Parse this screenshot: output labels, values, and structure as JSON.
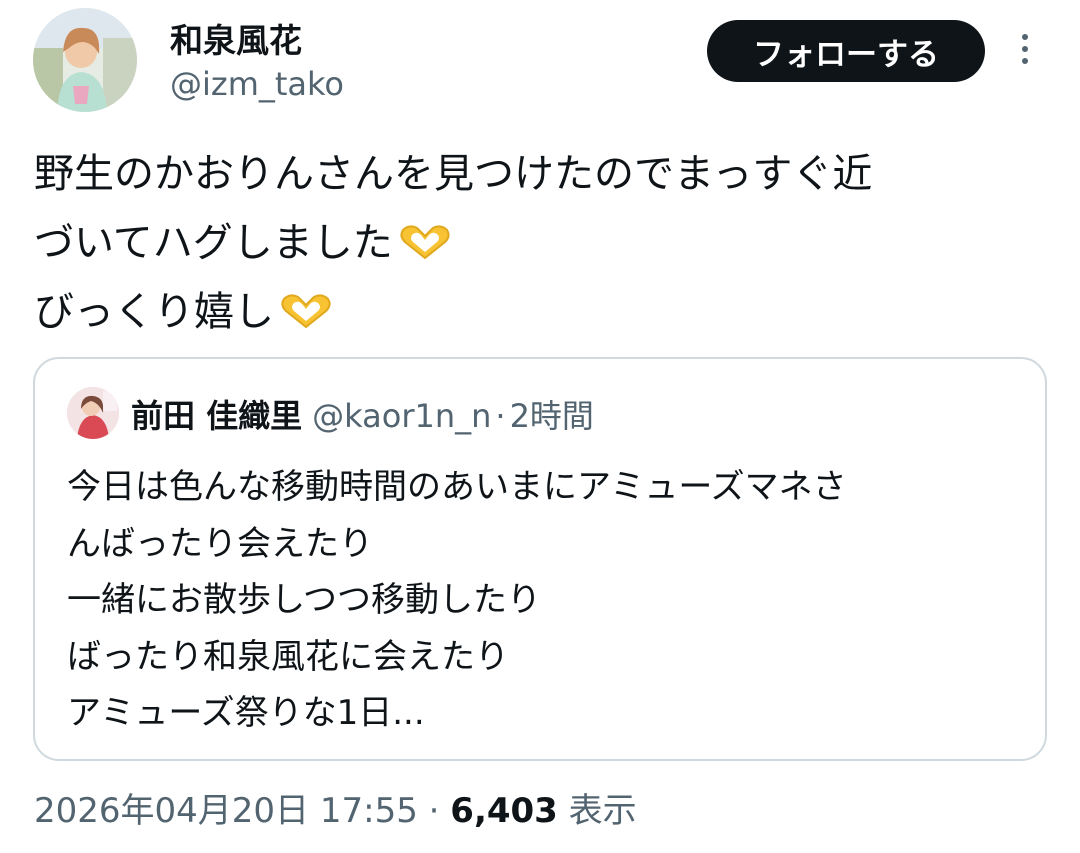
{
  "author": {
    "name": "和泉風花",
    "handle": "@izm_tako",
    "follow_label": "フォローする"
  },
  "post": {
    "lines": [
      "野生のかおりんさんを見つけたのでまっすぐ近",
      "づいてハグしました",
      "びっくり嬉し"
    ]
  },
  "quoted": {
    "name": "前田 佳織里",
    "handle": "@kaor1n_n",
    "separator": "·",
    "time": "2時間",
    "lines": [
      "今日は色んな移動時間のあいまにアミューズマネさ",
      "んばったり会えたり",
      "一緒にお散歩しつつ移動したり",
      "ばったり和泉風花に会えたり",
      "アミューズ祭りな1日..."
    ]
  },
  "meta": {
    "timestamp": "2026年04月20日 17:55",
    "separator": "·",
    "views": "6,403",
    "views_label": "表示"
  },
  "icons": {
    "more": "more-vertical-icon",
    "heart": "heart-hands-emoji"
  },
  "colors": {
    "text": "#0f1419",
    "secondary": "#536471",
    "border": "#cfd9de",
    "button_bg": "#0f1419",
    "emoji": "#f8c332"
  }
}
